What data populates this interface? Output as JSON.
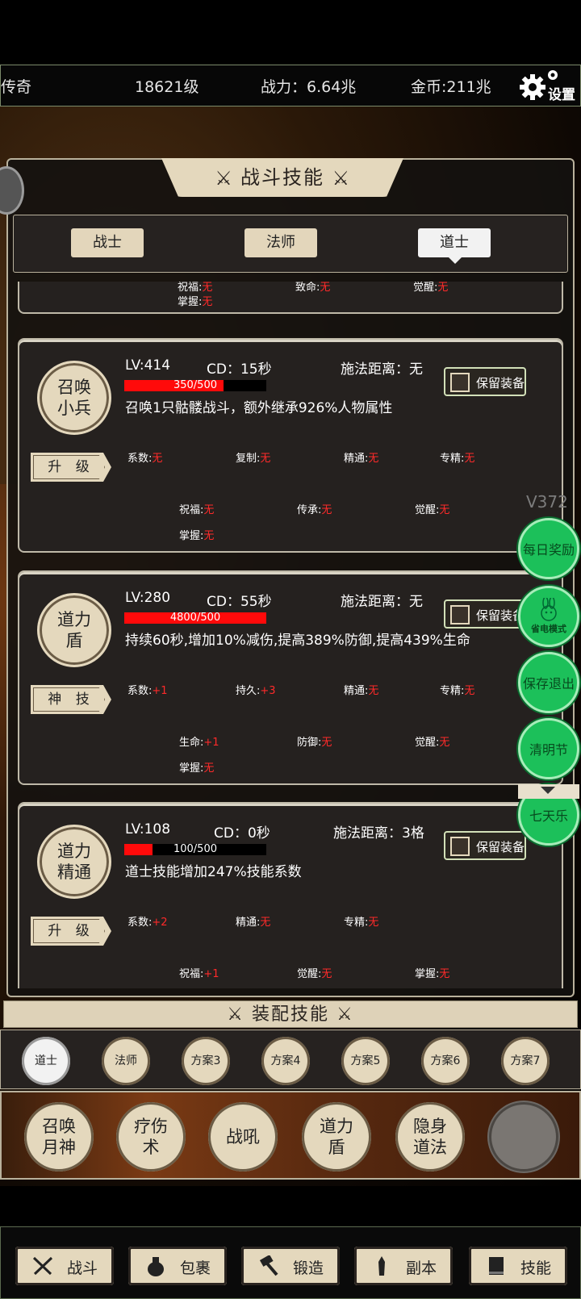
{
  "topbar": {
    "title": "传奇",
    "level": "18621级",
    "power": "战力：6.64兆",
    "gold": "金币:211兆",
    "settings": "设置"
  },
  "panel": {
    "title": "战斗技能"
  },
  "tabs": [
    {
      "label": "战士"
    },
    {
      "label": "法师"
    },
    {
      "label": "道士"
    }
  ],
  "partial_card": {
    "rows": [
      {
        "label": "祝福:",
        "value": "无"
      },
      {
        "label": "致命:",
        "value": "无"
      },
      {
        "label": "觉醒:",
        "value": "无"
      }
    ],
    "mastery": {
      "label": "掌握:",
      "value": "无"
    }
  },
  "cards": [
    {
      "name": "召唤小兵",
      "lv": "LV:414",
      "cd": "CD：15秒",
      "range": "施法距离：无",
      "progress_text": "350/500",
      "progress": 0.7,
      "desc": "召唤1只骷髅战斗，额外继承926%人物属性",
      "keep": "保留装备",
      "button": "升 级",
      "attrs": [
        {
          "label": "系数:",
          "value": "无"
        },
        {
          "label": "复制:",
          "value": "无"
        },
        {
          "label": "精通:",
          "value": "无"
        },
        {
          "label": "专精:",
          "value": "无"
        },
        {
          "label": "祝福:",
          "value": "无"
        },
        {
          "label": "传承:",
          "value": "无"
        },
        {
          "label": "觉醒:",
          "value": "无"
        },
        {
          "label": "掌握:",
          "value": "无"
        }
      ]
    },
    {
      "name": "道力盾",
      "lv": "LV:280",
      "cd": "CD：55秒",
      "range": "施法距离：无",
      "progress_text": "4800/500",
      "progress": 1.0,
      "desc": "持续60秒,增加10%减伤,提高389%防御,提高439%生命",
      "keep": "保留装备",
      "button": "神 技",
      "attrs": [
        {
          "label": "系数:",
          "value": "+1"
        },
        {
          "label": "持久:",
          "value": "+3"
        },
        {
          "label": "精通:",
          "value": "无"
        },
        {
          "label": "专精:",
          "value": "无"
        },
        {
          "label": "生命:",
          "value": "+1"
        },
        {
          "label": "防御:",
          "value": "无"
        },
        {
          "label": "觉醒:",
          "value": "无"
        },
        {
          "label": "掌握:",
          "value": "无"
        }
      ]
    },
    {
      "name": "道力精通",
      "lv": "LV:108",
      "cd": "CD：0秒",
      "range": "施法距离：3格",
      "progress_text": "100/500",
      "progress": 0.2,
      "desc": "道士技能增加247%技能系数",
      "keep": "保留装备",
      "button": "升 级",
      "attrs": [
        {
          "label": "系数:",
          "value": "+2"
        },
        {
          "label": "精通:",
          "value": "无"
        },
        {
          "label": "专精:",
          "value": "无"
        },
        {
          "label": "祝福:",
          "value": "+1"
        },
        {
          "label": "觉醒:",
          "value": "无"
        },
        {
          "label": "掌握:",
          "value": "无"
        }
      ]
    }
  ],
  "version": "V372",
  "float_buttons": [
    {
      "label": "每日奖励"
    },
    {
      "label": "省电模式"
    },
    {
      "label": "保存退出"
    },
    {
      "label": "清明节"
    },
    {
      "label": "七天乐"
    }
  ],
  "equip": {
    "title": "装配技能",
    "plans": [
      "道士",
      "法师",
      "方案3",
      "方案4",
      "方案5",
      "方案6",
      "方案7"
    ],
    "slots": [
      "召唤月神",
      "疗伤术",
      "战吼",
      "道力盾",
      "隐身道法"
    ]
  },
  "nav": [
    {
      "label": "战斗",
      "icon": "crossed-swords-icon"
    },
    {
      "label": "包裹",
      "icon": "bag-icon"
    },
    {
      "label": "锻造",
      "icon": "hammer-icon"
    },
    {
      "label": "副本",
      "icon": "tower-icon"
    },
    {
      "label": "技能",
      "icon": "book-icon"
    }
  ],
  "colors": {
    "accent_gold": "#e4d8bd",
    "value_red": "#ff2a2a",
    "float_green": "#1cc05a"
  }
}
